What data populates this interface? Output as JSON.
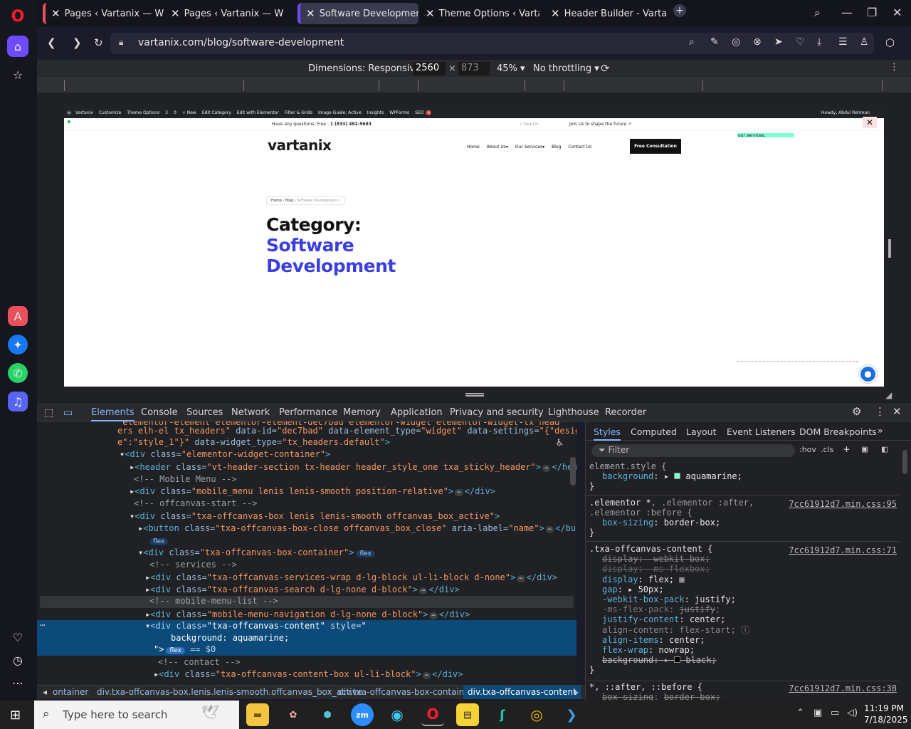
{
  "browser": {
    "tabs": [
      {
        "label": "Pages ‹ Vartanix — WordP",
        "active": false
      },
      {
        "label": "Pages ‹ Vartanix — WordP",
        "active": false
      },
      {
        "label": "Software Development - V",
        "active": true
      },
      {
        "label": "Theme Options ‹ Vartanix",
        "active": false
      },
      {
        "label": "Header Builder - Vartanix",
        "active": false
      }
    ],
    "new_tab": "+",
    "url": "vartanix.com/blog/software-development"
  },
  "device_toolbar": {
    "dimensions_label": "Dimensions: Responsive",
    "width": "2560",
    "height": "873",
    "times": "×",
    "zoom": "45%",
    "throttling": "No throttling"
  },
  "site": {
    "adminbar": {
      "items": [
        "Vartanix",
        "Customize",
        "Theme Options",
        "3",
        "0",
        "+ New",
        "Edit Category",
        "Edit with Elementor",
        "Filter & Grids",
        "Image Guide: Active",
        "Insights",
        "WPForms",
        "SEO"
      ],
      "seo_count": "6",
      "howdy": "Howdy, Abdul Rehman"
    },
    "topbar": {
      "question": "Have any questions: Free : ",
      "phone": "1 (833) 482-5683",
      "search_placeholder": "Search",
      "join": "Join Us to shape the future"
    },
    "logo": "vartanix",
    "nav": [
      "Home",
      "About Us",
      "Our Services",
      "Blog",
      "Contact Us"
    ],
    "cta": "Free Consultation",
    "offcanvas_text": "our services.",
    "breadcrumb": [
      "Home",
      "Blog",
      "Software Development"
    ],
    "heading_prefix": "Category:",
    "heading_line1": "Software",
    "heading_line2": "Development"
  },
  "devtools": {
    "tabs": [
      "Elements",
      "Console",
      "Sources",
      "Network",
      "Performance",
      "Memory",
      "Application",
      "Privacy and security",
      "Lighthouse",
      "Recorder"
    ],
    "breadcrumb": [
      "ontainer",
      "div.txa-offcanvas-box.lenis.lenis-smooth.offcanvas_box_active",
      "div.txa-offcanvas-box-container",
      "div.txa-offcanvas-content"
    ],
    "styles_tabs": [
      "Styles",
      "Computed",
      "Layout",
      "Event Listeners",
      "DOM Breakpoints"
    ],
    "filter_placeholder": "Filter",
    "hov": ":hov",
    "cls": ".cls",
    "element_style": "element.style {",
    "bg_prop": "background",
    "bg_val": "aquamarine;",
    "rule1_sel": ".elementor *",
    "rule1_sel_rest": ", .elementor :after,",
    "rule1_sel2": ".elementor :before {",
    "rule1_src": "7cc61912d7.min.css:95",
    "box_sizing": "box-sizing",
    "border_box": "border-box;",
    "rule2_sel": ".txa-offcanvas-content {",
    "rule2_src": "7cc61912d7.min.css:71",
    "rule3_sel": "*, ::after, ::before {",
    "rule3_src": "7cc61912d7.min.css:38",
    "brace": "}"
  },
  "taskbar": {
    "search_placeholder": "Type here to search",
    "time": "11:19 PM",
    "date": "7/18/2025"
  }
}
